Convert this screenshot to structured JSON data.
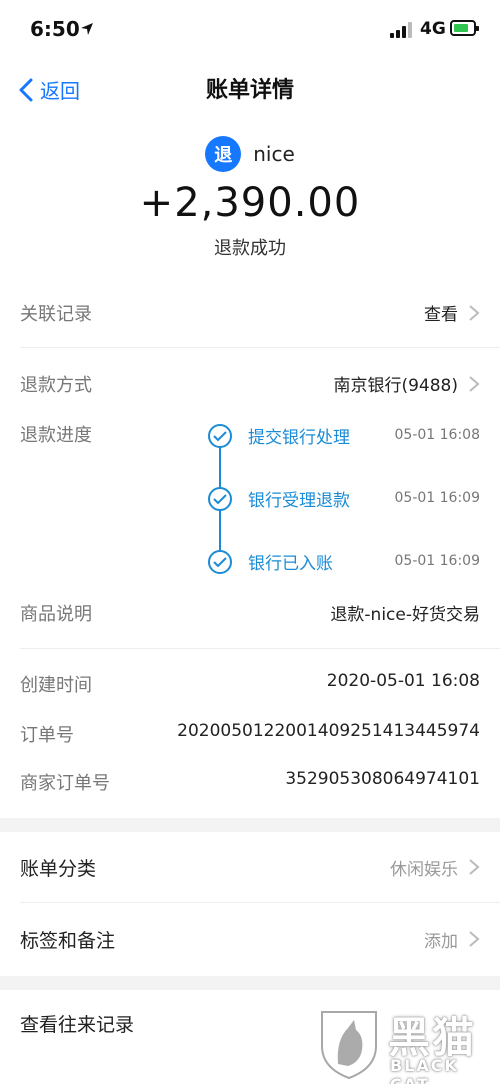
{
  "status_bar": {
    "time": "6:50",
    "network": "4G"
  },
  "nav": {
    "back_label": "返回",
    "title": "账单详情"
  },
  "header": {
    "merchant_icon_char": "退",
    "merchant_name": "nice",
    "amount": "+2,390.00",
    "status": "退款成功"
  },
  "related": {
    "label": "关联记录",
    "value": "查看"
  },
  "refund_method": {
    "label": "退款方式",
    "value": "南京银行(9488)"
  },
  "refund_progress": {
    "label": "退款进度",
    "steps": [
      {
        "text": "提交银行处理",
        "time": "05-01 16:08"
      },
      {
        "text": "银行受理退款",
        "time": "05-01 16:09"
      },
      {
        "text": "银行已入账",
        "time": "05-01 16:09"
      }
    ]
  },
  "product_desc": {
    "label": "商品说明",
    "value": "退款-nice-好货交易"
  },
  "created_time": {
    "label": "创建时间",
    "value": "2020-05-01 16:08"
  },
  "order_no": {
    "label": "订单号",
    "value": "20200501220014092514134459​74"
  },
  "merchant_order_no": {
    "label": "商家订单号",
    "value": "352905308064974101"
  },
  "category": {
    "label": "账单分类",
    "value": "休闲娱乐"
  },
  "tags": {
    "label": "标签和备注",
    "value": "添加"
  },
  "history": {
    "label": "查看往来记录"
  },
  "watermark": {
    "title": "黑猫",
    "subtitle": "BLACK CAT"
  },
  "colors": {
    "accent": "#1677ff",
    "timeline": "#1b8bd6",
    "battery": "#31c451"
  }
}
